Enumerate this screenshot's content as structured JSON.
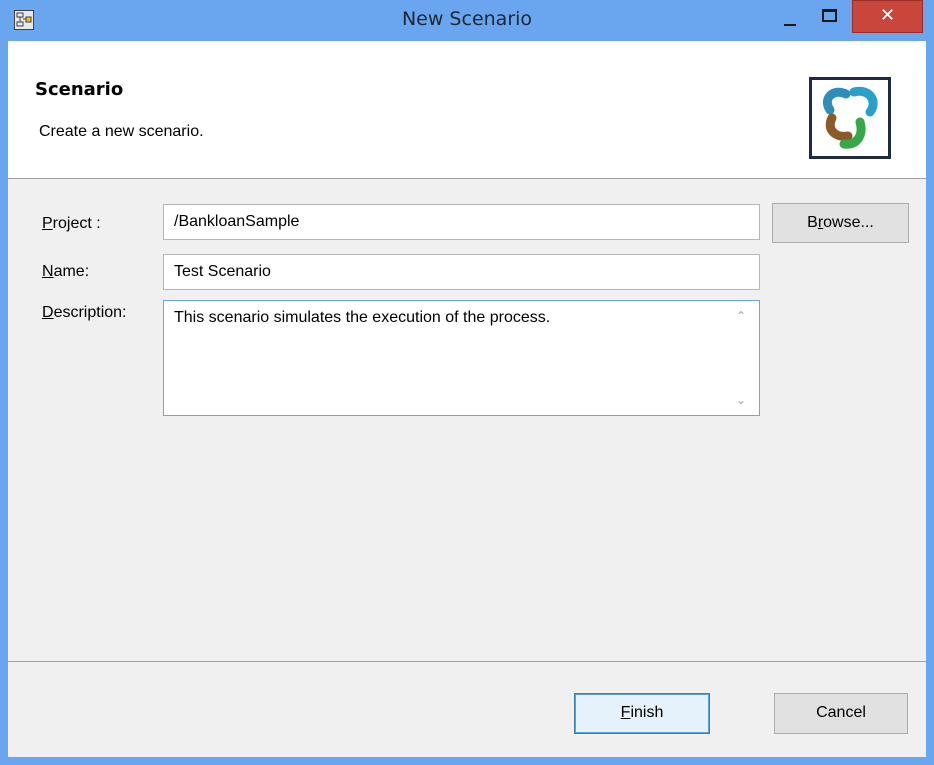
{
  "window": {
    "title": "New Scenario",
    "icons": {
      "app": "wizard-app-icon",
      "minimize": "minimize-icon",
      "maximize": "maximize-icon",
      "close": "close-icon"
    },
    "close_glyph": "✕"
  },
  "banner": {
    "title": "Scenario",
    "description": "Create a new scenario.",
    "logo": "scenario-logo-icon"
  },
  "form": {
    "project_label_mnemonic": "P",
    "project_label_rest": "roject :",
    "project_value": "/BankloanSample",
    "browse_label_pre": "B",
    "browse_label_mnemonic": "r",
    "browse_label_post": "owse...",
    "name_label_mnemonic": "N",
    "name_label_rest": "ame:",
    "name_value": "Test Scenario",
    "description_label_mnemonic": "D",
    "description_label_rest": "escription:",
    "description_value": "This scenario simulates the execution of the process."
  },
  "footer": {
    "finish_mnemonic": "F",
    "finish_rest": "inish",
    "cancel_label": "Cancel"
  },
  "colors": {
    "titlebar": "#6aa6f0",
    "close": "#c9463d",
    "panel": "#f0f0f0",
    "focus_border": "#6aa6e4"
  }
}
